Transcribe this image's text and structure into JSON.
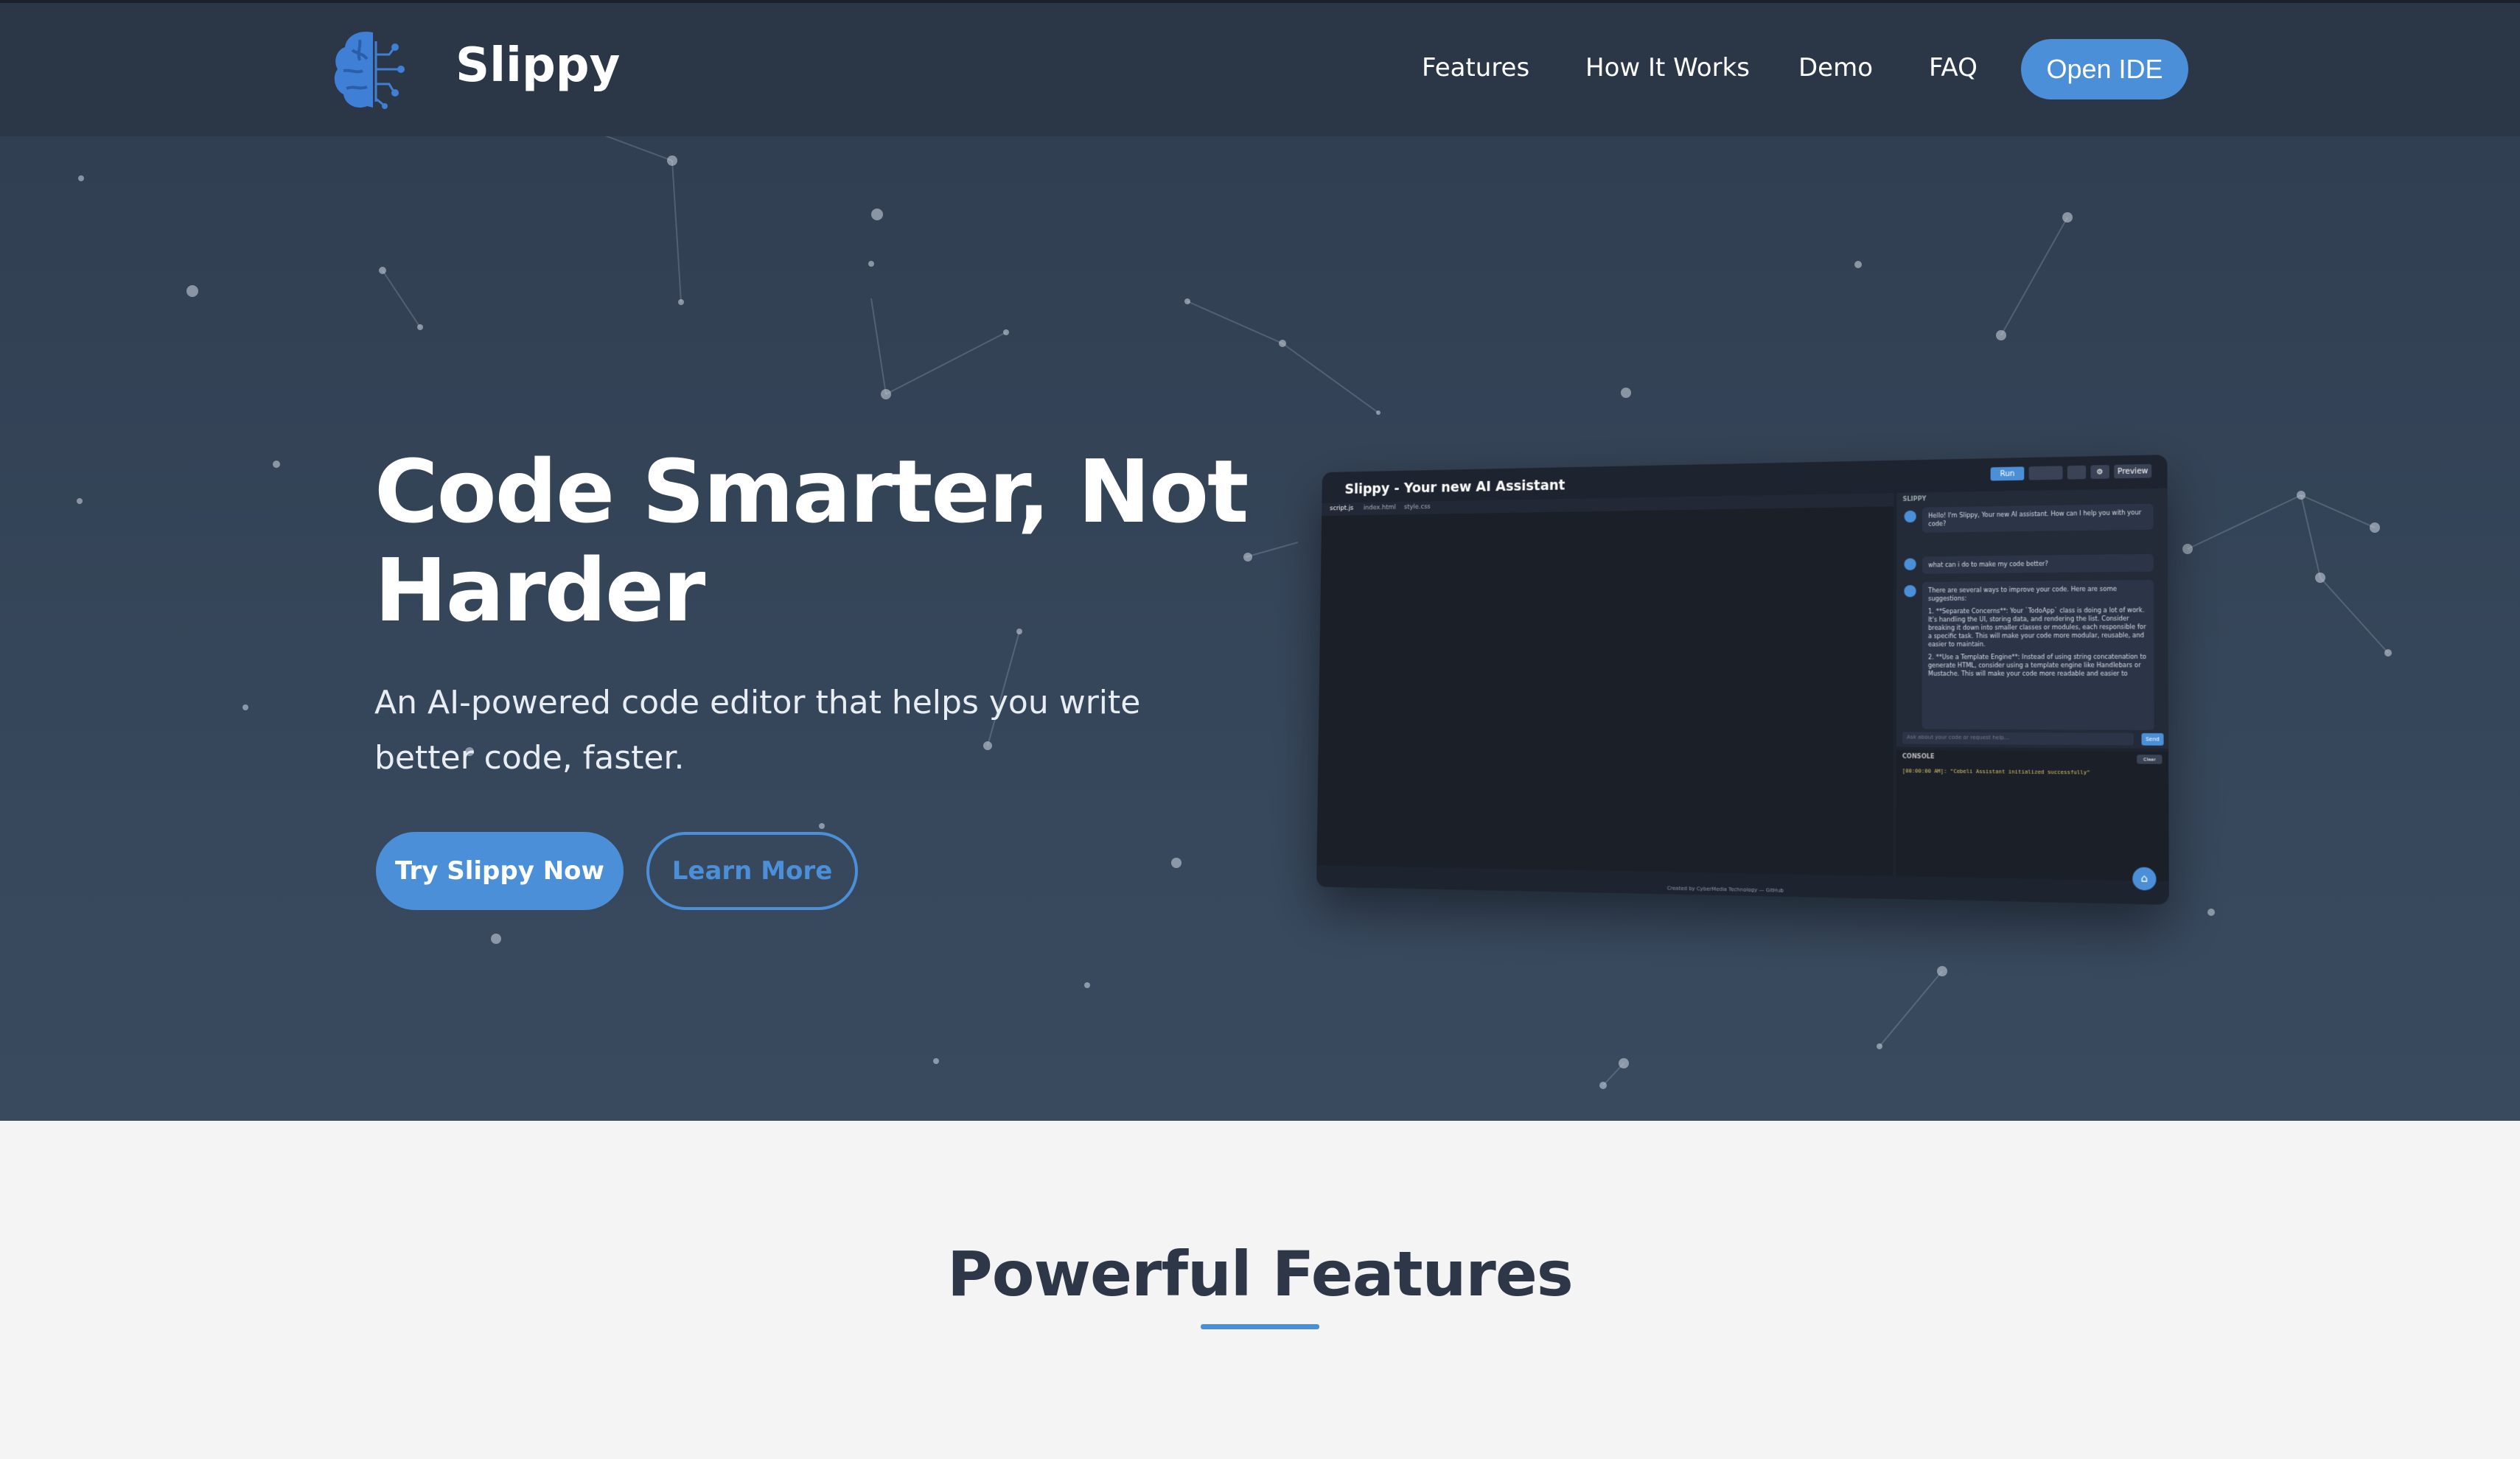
{
  "header": {
    "brand": "Slippy",
    "nav": [
      {
        "label": "Features"
      },
      {
        "label": "How It Works"
      },
      {
        "label": "Demo"
      },
      {
        "label": "FAQ"
      }
    ],
    "cta_label": "Open IDE"
  },
  "hero": {
    "title": "Code Smarter, Not Harder",
    "subtitle": "An AI-powered code editor that helps you write better code, faster.",
    "primary_button": "Try Slippy Now",
    "secondary_button": "Learn More"
  },
  "screenshot": {
    "title": "Slippy - Your new AI Assistant",
    "toolbar": [
      "Run",
      "",
      "",
      "",
      "Preview"
    ],
    "tabs": [
      "script.js",
      "index.html",
      "style.css"
    ],
    "assistant_label": "SLIPPY",
    "messages": [
      "Hello! I'm Slippy, Your new AI assistant. How can I help you with your code?",
      "what can i do to make my code better?",
      "There are several ways to improve your code. Here are some suggestions:",
      "1. **Separate Concerns**: Your `TodoApp` class is doing a lot of work. It's handling the UI, storing data, and rendering the list. Consider breaking it down into smaller classes or modules, each responsible for a specific task. This will make your code more modular, reusable, and easier to maintain.",
      "2. **Use a Template Engine**: Instead of using string concatenation to generate HTML, consider using a template engine like Handlebars or Mustache. This will make your code more readable and easier to"
    ],
    "input_placeholder": "Ask about your code or request help...",
    "send_label": "Send",
    "console_label": "CONSOLE",
    "clear_label": "Clear",
    "console_line": "[00:00:00 AM]: \"Cebeli Assistant initialized successfully\"",
    "footer": "Created by CyberMedia Technology — GitHub",
    "home_icon": "home-icon"
  },
  "features": {
    "title": "Powerful Features"
  },
  "colors": {
    "accent": "#4a8fd8",
    "hero_bg": "#34435a",
    "header_bg": "#2b3747",
    "page_bg": "#f4f4f4",
    "heading_dark": "#2d3748"
  }
}
